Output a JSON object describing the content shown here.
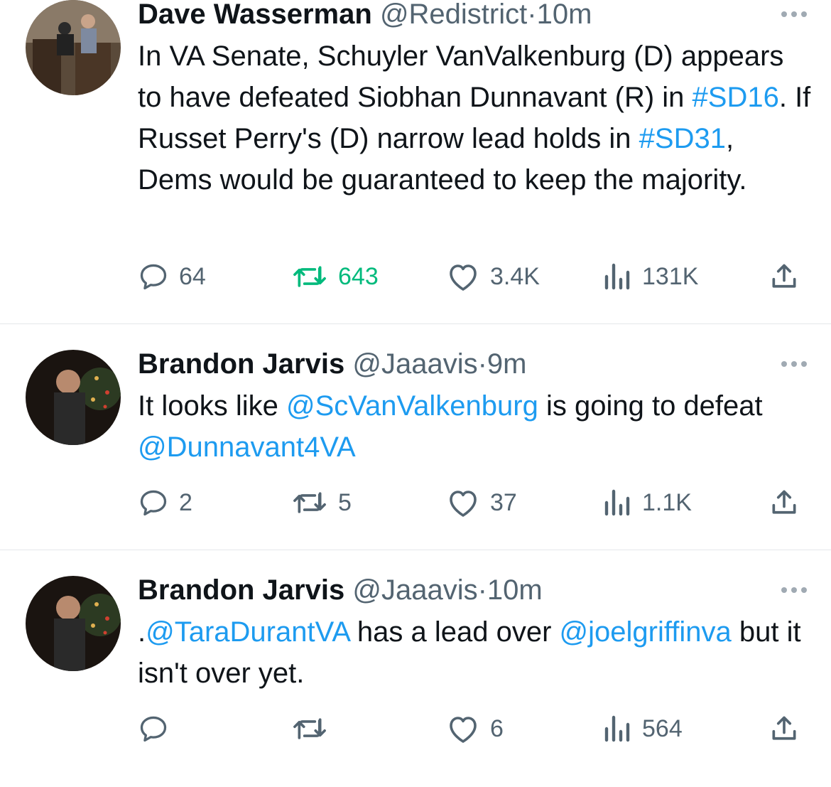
{
  "tweets": [
    {
      "author": "Dave Wasserman",
      "handle": "@Redistrict",
      "separator": "·",
      "time": "10m",
      "text": {
        "s1": "In VA Senate, Schuyler VanValkenburg (D) appears to have defeated Siobhan Dunnavant (R) in ",
        "tag1": "#SD16",
        "s2": ". If Russet Perry's (D) narrow lead holds in ",
        "tag2": "#SD31",
        "s3": ", Dems would be guaranteed to keep the majority."
      },
      "replies": "64",
      "retweets": "643",
      "likes": "3.4K",
      "views": "131K",
      "retweeted": true
    },
    {
      "author": "Brandon Jarvis",
      "handle": "@Jaaavis",
      "separator": "·",
      "time": "9m",
      "text": {
        "s1": "It looks like ",
        "mention1": "@ScVanValkenburg",
        "s2": " is going to defeat ",
        "mention2": "@Dunnavant4VA"
      },
      "replies": "2",
      "retweets": "5",
      "likes": "37",
      "views": "1.1K",
      "retweeted": false
    },
    {
      "author": "Brandon Jarvis",
      "handle": "@Jaaavis",
      "separator": "·",
      "time": "10m",
      "text": {
        "s1": ".",
        "mention1": "@TaraDurantVA",
        "s2": " has a lead over ",
        "mention2": "@joelgriffinva",
        "s3": " but it isn't over yet."
      },
      "replies": "",
      "retweets": "",
      "likes": "6",
      "views": "564",
      "retweeted": false
    }
  ],
  "icons": {
    "reply": "reply-icon",
    "retweet": "retweet-icon",
    "like": "heart-icon",
    "views": "views-icon",
    "share": "share-icon",
    "more": "more-icon"
  },
  "colors": {
    "link": "#1d9bf0",
    "muted": "#536471",
    "text": "#0f1419",
    "retweet_active": "#00ba7c",
    "divider": "#e4e7ea"
  }
}
